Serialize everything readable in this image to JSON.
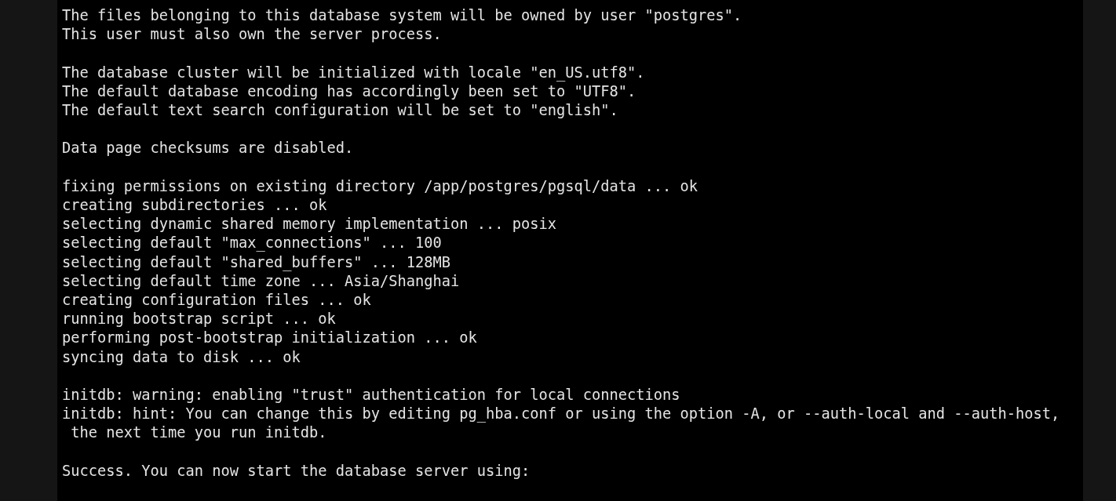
{
  "terminal": {
    "paragraphs": [
      [
        "The files belonging to this database system will be owned by user \"postgres\".",
        "This user must also own the server process."
      ],
      [
        "The database cluster will be initialized with locale \"en_US.utf8\".",
        "The default database encoding has accordingly been set to \"UTF8\".",
        "The default text search configuration will be set to \"english\"."
      ],
      [
        "Data page checksums are disabled."
      ],
      [
        "fixing permissions on existing directory /app/postgres/pgsql/data ... ok",
        "creating subdirectories ... ok",
        "selecting dynamic shared memory implementation ... posix",
        "selecting default \"max_connections\" ... 100",
        "selecting default \"shared_buffers\" ... 128MB",
        "selecting default time zone ... Asia/Shanghai",
        "creating configuration files ... ok",
        "running bootstrap script ... ok",
        "performing post-bootstrap initialization ... ok",
        "syncing data to disk ... ok"
      ],
      [
        "initdb: warning: enabling \"trust\" authentication for local connections",
        "initdb: hint: You can change this by editing pg_hba.conf or using the option -A, or --auth-local and --auth-host,",
        " the next time you run initdb."
      ],
      [
        "Success. You can now start the database server using:"
      ]
    ]
  }
}
